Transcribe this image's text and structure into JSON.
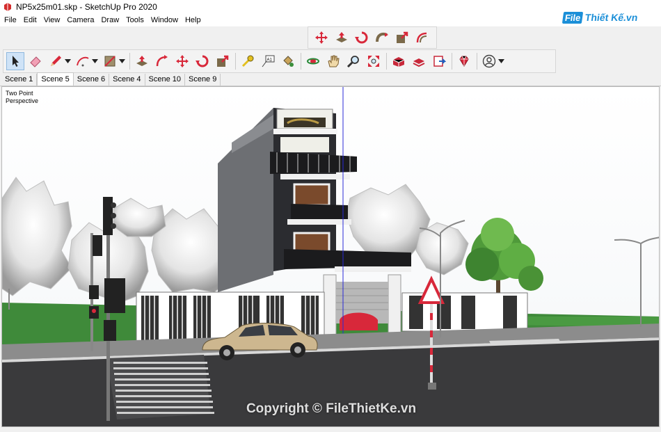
{
  "window": {
    "title": "NP5x25m01.skp - SketchUp Pro 2020"
  },
  "menu": [
    "File",
    "Edit",
    "View",
    "Camera",
    "Draw",
    "Tools",
    "Window",
    "Help"
  ],
  "logo": {
    "file": "File",
    "rest": "Thiết Kế.vn"
  },
  "toolbar_top": {
    "tools": [
      "move-icon",
      "push-pull-icon",
      "rotate-icon",
      "follow-me-icon",
      "scale-icon",
      "offset-icon"
    ]
  },
  "toolbar_main": {
    "tools": [
      "select-icon",
      "eraser-icon",
      "pencil-icon",
      "arc-icon",
      "shape-icon",
      "push-pull-icon",
      "offset-icon",
      "move-icon",
      "rotate-icon",
      "scale-icon",
      "tape-measure-icon",
      "text-icon",
      "paint-bucket-icon",
      "orbit-icon",
      "pan-icon",
      "zoom-icon",
      "zoom-extents-icon",
      "warehouse-icon",
      "extension-warehouse-icon",
      "send-to-layout-icon",
      "ruby-icon",
      "account-icon"
    ]
  },
  "scenes": {
    "tabs": [
      "Scene 1",
      "Scene 5",
      "Scene 6",
      "Scene 4",
      "Scene 10",
      "Scene 9"
    ],
    "active": "Scene 5"
  },
  "viewport": {
    "label_line1": "Two Point",
    "label_line2": "Perspective",
    "watermark": "Copyright © FileThietKe.vn"
  }
}
